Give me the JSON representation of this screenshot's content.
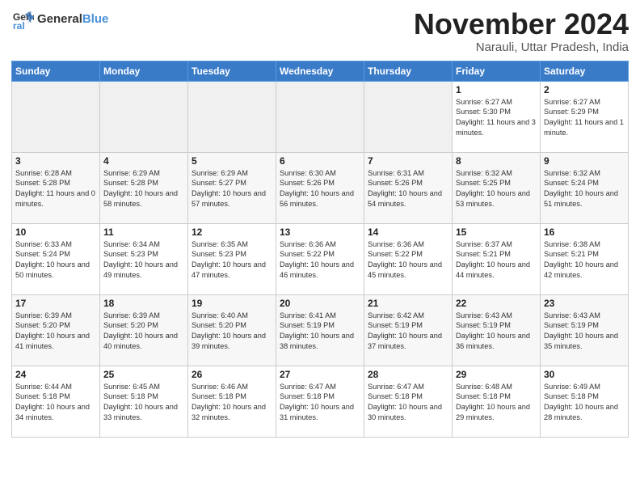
{
  "logo": {
    "text_general": "General",
    "text_blue": "Blue"
  },
  "title": "November 2024",
  "subtitle": "Narauli, Uttar Pradesh, India",
  "days_of_week": [
    "Sunday",
    "Monday",
    "Tuesday",
    "Wednesday",
    "Thursday",
    "Friday",
    "Saturday"
  ],
  "weeks": [
    [
      {
        "num": "",
        "info": ""
      },
      {
        "num": "",
        "info": ""
      },
      {
        "num": "",
        "info": ""
      },
      {
        "num": "",
        "info": ""
      },
      {
        "num": "",
        "info": ""
      },
      {
        "num": "1",
        "info": "Sunrise: 6:27 AM\nSunset: 5:30 PM\nDaylight: 11 hours and 3 minutes."
      },
      {
        "num": "2",
        "info": "Sunrise: 6:27 AM\nSunset: 5:29 PM\nDaylight: 11 hours and 1 minute."
      }
    ],
    [
      {
        "num": "3",
        "info": "Sunrise: 6:28 AM\nSunset: 5:28 PM\nDaylight: 11 hours and 0 minutes."
      },
      {
        "num": "4",
        "info": "Sunrise: 6:29 AM\nSunset: 5:28 PM\nDaylight: 10 hours and 58 minutes."
      },
      {
        "num": "5",
        "info": "Sunrise: 6:29 AM\nSunset: 5:27 PM\nDaylight: 10 hours and 57 minutes."
      },
      {
        "num": "6",
        "info": "Sunrise: 6:30 AM\nSunset: 5:26 PM\nDaylight: 10 hours and 56 minutes."
      },
      {
        "num": "7",
        "info": "Sunrise: 6:31 AM\nSunset: 5:26 PM\nDaylight: 10 hours and 54 minutes."
      },
      {
        "num": "8",
        "info": "Sunrise: 6:32 AM\nSunset: 5:25 PM\nDaylight: 10 hours and 53 minutes."
      },
      {
        "num": "9",
        "info": "Sunrise: 6:32 AM\nSunset: 5:24 PM\nDaylight: 10 hours and 51 minutes."
      }
    ],
    [
      {
        "num": "10",
        "info": "Sunrise: 6:33 AM\nSunset: 5:24 PM\nDaylight: 10 hours and 50 minutes."
      },
      {
        "num": "11",
        "info": "Sunrise: 6:34 AM\nSunset: 5:23 PM\nDaylight: 10 hours and 49 minutes."
      },
      {
        "num": "12",
        "info": "Sunrise: 6:35 AM\nSunset: 5:23 PM\nDaylight: 10 hours and 47 minutes."
      },
      {
        "num": "13",
        "info": "Sunrise: 6:36 AM\nSunset: 5:22 PM\nDaylight: 10 hours and 46 minutes."
      },
      {
        "num": "14",
        "info": "Sunrise: 6:36 AM\nSunset: 5:22 PM\nDaylight: 10 hours and 45 minutes."
      },
      {
        "num": "15",
        "info": "Sunrise: 6:37 AM\nSunset: 5:21 PM\nDaylight: 10 hours and 44 minutes."
      },
      {
        "num": "16",
        "info": "Sunrise: 6:38 AM\nSunset: 5:21 PM\nDaylight: 10 hours and 42 minutes."
      }
    ],
    [
      {
        "num": "17",
        "info": "Sunrise: 6:39 AM\nSunset: 5:20 PM\nDaylight: 10 hours and 41 minutes."
      },
      {
        "num": "18",
        "info": "Sunrise: 6:39 AM\nSunset: 5:20 PM\nDaylight: 10 hours and 40 minutes."
      },
      {
        "num": "19",
        "info": "Sunrise: 6:40 AM\nSunset: 5:20 PM\nDaylight: 10 hours and 39 minutes."
      },
      {
        "num": "20",
        "info": "Sunrise: 6:41 AM\nSunset: 5:19 PM\nDaylight: 10 hours and 38 minutes."
      },
      {
        "num": "21",
        "info": "Sunrise: 6:42 AM\nSunset: 5:19 PM\nDaylight: 10 hours and 37 minutes."
      },
      {
        "num": "22",
        "info": "Sunrise: 6:43 AM\nSunset: 5:19 PM\nDaylight: 10 hours and 36 minutes."
      },
      {
        "num": "23",
        "info": "Sunrise: 6:43 AM\nSunset: 5:19 PM\nDaylight: 10 hours and 35 minutes."
      }
    ],
    [
      {
        "num": "24",
        "info": "Sunrise: 6:44 AM\nSunset: 5:18 PM\nDaylight: 10 hours and 34 minutes."
      },
      {
        "num": "25",
        "info": "Sunrise: 6:45 AM\nSunset: 5:18 PM\nDaylight: 10 hours and 33 minutes."
      },
      {
        "num": "26",
        "info": "Sunrise: 6:46 AM\nSunset: 5:18 PM\nDaylight: 10 hours and 32 minutes."
      },
      {
        "num": "27",
        "info": "Sunrise: 6:47 AM\nSunset: 5:18 PM\nDaylight: 10 hours and 31 minutes."
      },
      {
        "num": "28",
        "info": "Sunrise: 6:47 AM\nSunset: 5:18 PM\nDaylight: 10 hours and 30 minutes."
      },
      {
        "num": "29",
        "info": "Sunrise: 6:48 AM\nSunset: 5:18 PM\nDaylight: 10 hours and 29 minutes."
      },
      {
        "num": "30",
        "info": "Sunrise: 6:49 AM\nSunset: 5:18 PM\nDaylight: 10 hours and 28 minutes."
      }
    ]
  ]
}
